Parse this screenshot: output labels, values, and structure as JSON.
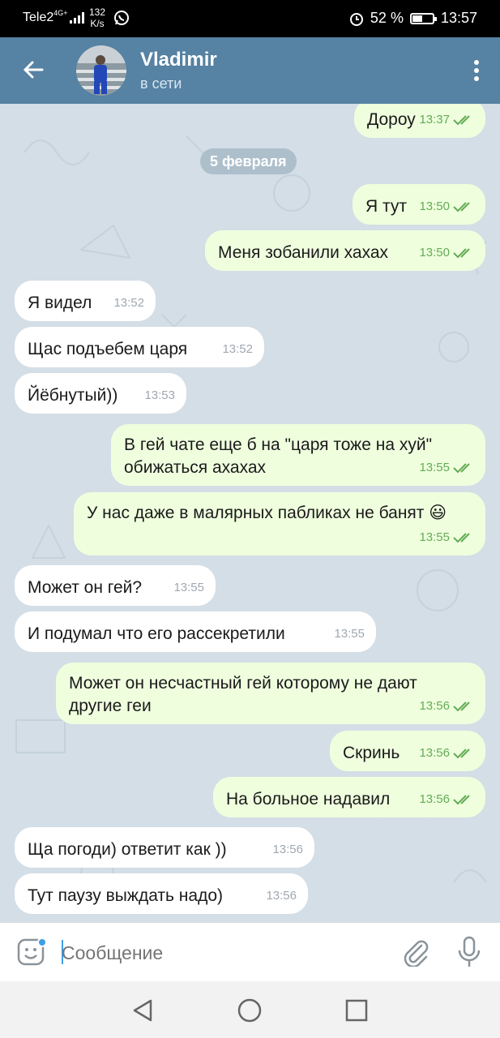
{
  "statusbar": {
    "carrier": "Tele2",
    "network": "4G+",
    "speed_value": "132",
    "speed_unit": "K/s",
    "battery": "52 %",
    "battery_level": 0.52,
    "time": "13:57"
  },
  "header": {
    "name": "Vladimir",
    "status": "в сети"
  },
  "chat": {
    "date": "5 февраля",
    "messages": [
      {
        "dir": "out",
        "text": "Дороу",
        "time": "13:37"
      },
      {
        "dir": "out",
        "text": "Я тут",
        "time": "13:50"
      },
      {
        "dir": "out",
        "text": "Меня зобанили хахах",
        "time": "13:50"
      },
      {
        "dir": "in",
        "text": "Я видел",
        "time": "13:52"
      },
      {
        "dir": "in",
        "text": "Щас подъебем царя",
        "time": "13:52"
      },
      {
        "dir": "in",
        "text": "Йёбнутый))",
        "time": "13:53"
      },
      {
        "dir": "out",
        "text": "В гей чате еще б на \"царя тоже  на хуй\" обижаться ахахах",
        "time": "13:55"
      },
      {
        "dir": "out",
        "text": "У нас даже в малярных пабликах не банят 😃",
        "time": "13:55"
      },
      {
        "dir": "in",
        "text": "Может он гей?",
        "time": "13:55"
      },
      {
        "dir": "in",
        "text": "И подумал что его рассекретили",
        "time": "13:55"
      },
      {
        "dir": "out",
        "text": "Может он несчастный гей которому не дают другие геи",
        "time": "13:56"
      },
      {
        "dir": "out",
        "text": "Скринь",
        "time": "13:56"
      },
      {
        "dir": "out",
        "text": "На больное надавил",
        "time": "13:56"
      },
      {
        "dir": "in",
        "text": "Ща погоди) ответит как ))",
        "time": "13:56"
      },
      {
        "dir": "in",
        "text": "Тут паузу выждать надо)",
        "time": "13:56"
      }
    ]
  },
  "composer": {
    "placeholder": "Сообщение"
  },
  "colors": {
    "header": "#5682a3",
    "outgoing": "#efffde",
    "incoming": "#ffffff",
    "check": "#62ac55",
    "background": "#d4dee6"
  }
}
